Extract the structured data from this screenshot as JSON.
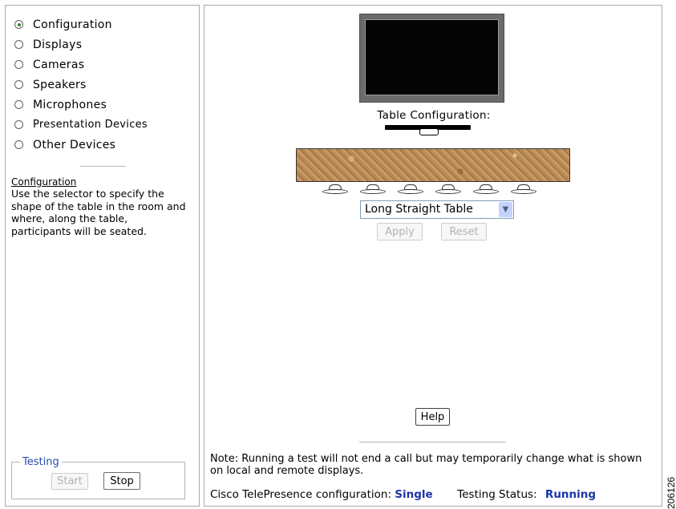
{
  "nav": {
    "items": [
      {
        "label": "Configuration",
        "selected": true
      },
      {
        "label": "Displays",
        "selected": false
      },
      {
        "label": "Cameras",
        "selected": false
      },
      {
        "label": "Speakers",
        "selected": false
      },
      {
        "label": "Microphones",
        "selected": false
      },
      {
        "label": "Presentation Devices",
        "selected": false
      },
      {
        "label": "Other Devices",
        "selected": false
      }
    ]
  },
  "help": {
    "title": "Configuration",
    "text": "Use the selector to specify the shape of the table in the room and where, along the table, participants will be seated."
  },
  "testing": {
    "legend": "Testing",
    "start_label": "Start",
    "stop_label": "Stop"
  },
  "main": {
    "table_config_label": "Table Configuration:",
    "table_select_value": "Long Straight Table",
    "seat_count": 6,
    "apply_label": "Apply",
    "reset_label": "Reset",
    "help_label": "Help",
    "note": "Note: Running a test will not end a call but may temporarily change what is shown on local and remote displays.",
    "config_label": "Cisco TelePresence configuration:",
    "config_value": "Single",
    "status_label": "Testing Status:",
    "status_value": "Running"
  },
  "figure_number": "206126",
  "colors": {
    "accent_blue": "#1d35a6",
    "legend_blue": "#2a4aa8",
    "radio_selected": "#2f8a2f"
  }
}
